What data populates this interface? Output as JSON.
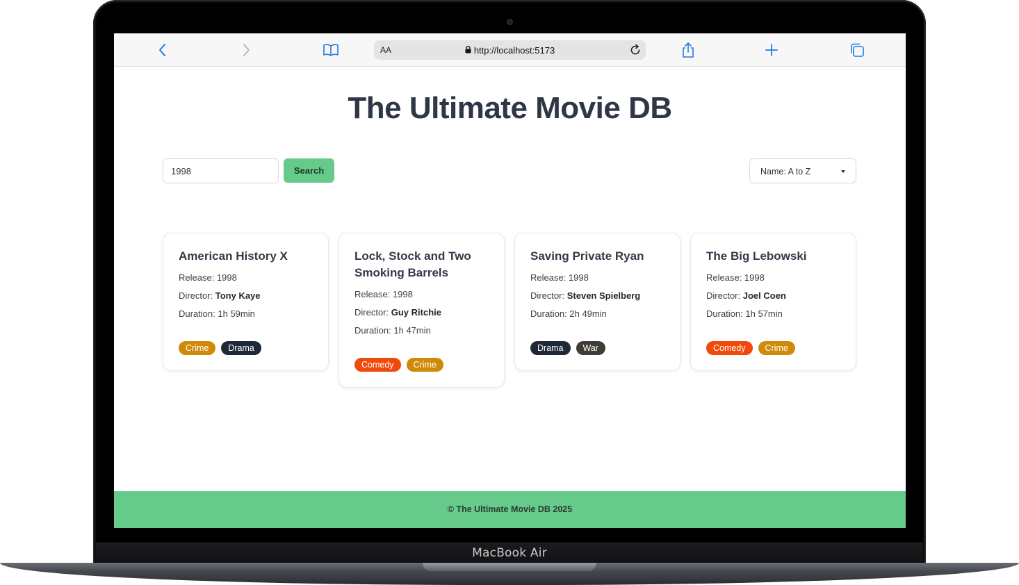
{
  "device": {
    "brand": "MacBook Air"
  },
  "browser": {
    "address_prefix": "AA",
    "url": "http://localhost:5173",
    "icons": [
      "back-icon",
      "forward-icon",
      "bookmarks-icon",
      "lock-icon",
      "reload-icon",
      "share-icon",
      "new-tab-icon",
      "tabs-overview-icon"
    ]
  },
  "page": {
    "title": "The Ultimate Movie DB",
    "search": {
      "value": "1998",
      "button_label": "Search"
    },
    "sort": {
      "selected": "Name: A to Z"
    },
    "labels": {
      "release": "Release: ",
      "director": "Director: ",
      "duration": "Duration: "
    },
    "movies": [
      {
        "title": "American History X",
        "release": "1998",
        "director": "Tony Kaye",
        "duration": "1h 59min",
        "genres": [
          "Crime",
          "Drama"
        ]
      },
      {
        "title": "Lock, Stock and Two Smoking Barrels",
        "release": "1998",
        "director": "Guy Ritchie",
        "duration": "1h 47min",
        "genres": [
          "Comedy",
          "Crime"
        ]
      },
      {
        "title": "Saving Private Ryan",
        "release": "1998",
        "director": "Steven Spielberg",
        "duration": "2h 49min",
        "genres": [
          "Drama",
          "War"
        ]
      },
      {
        "title": "The Big Lebowski",
        "release": "1998",
        "director": "Joel Coen",
        "duration": "1h 57min",
        "genres": [
          "Comedy",
          "Crime"
        ]
      }
    ],
    "genre_colors": {
      "Crime": "#d08a0a",
      "Drama": "#1f2838",
      "Comedy": "#ef4a0c",
      "War": "#403d36"
    },
    "footer": "© The Ultimate Movie DB 2025"
  },
  "colors": {
    "accent": "#66cb8a",
    "title": "#2f3747",
    "browser_icon": "#1f7ae0"
  }
}
